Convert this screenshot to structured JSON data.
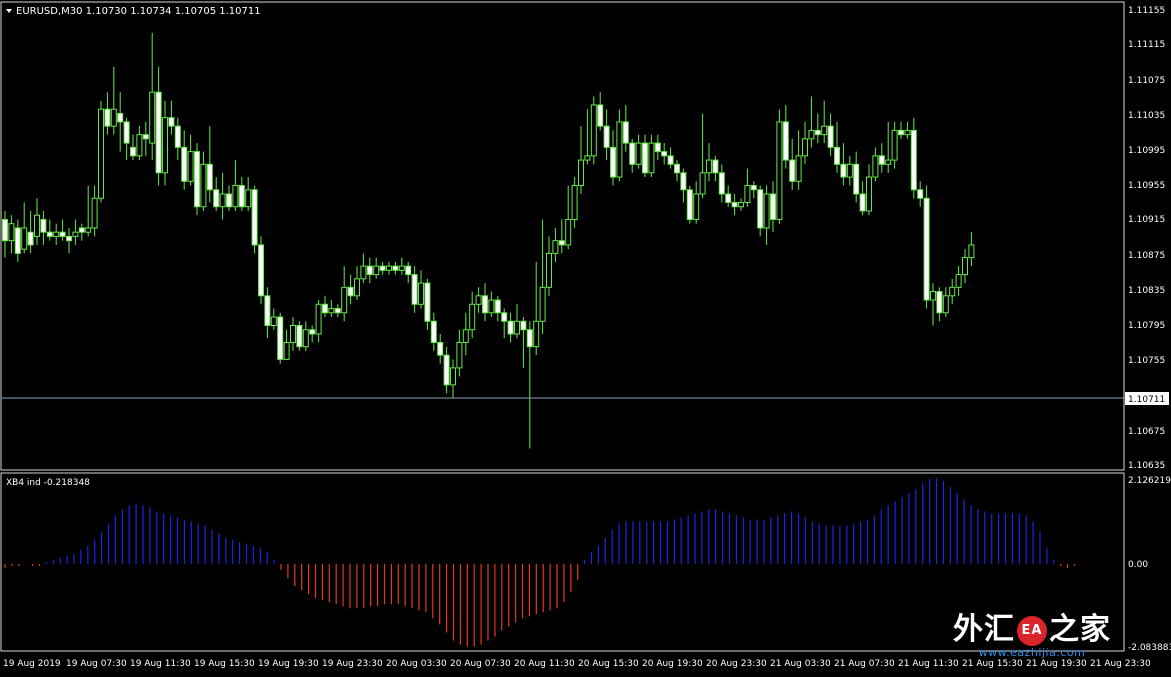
{
  "colors": {
    "background": "#000000",
    "frame": "#d9d9d9",
    "axis_text": "#ffffff",
    "candle": "#66e84a",
    "candle_bull_body": "#000000",
    "candle_bear_body": "#ffffff",
    "current_price_line": "#8aa2b5",
    "hist_positive": "#2222e6",
    "hist_negative": "#e23b1b"
  },
  "main_pane": {
    "symbol_menu_icon": "triangle-down-icon",
    "title": "EURUSD,M30  1.10730 1.10734 1.10705 1.10711",
    "price_labels": [
      "1.11155",
      "1.11115",
      "1.11075",
      "1.11035",
      "1.10995",
      "1.10955",
      "1.10915",
      "1.10875",
      "1.10835",
      "1.10795",
      "1.10755",
      "1.10675",
      "1.10635"
    ],
    "current_price": "1.10711"
  },
  "indicator_pane": {
    "title": "XB4 ind -0.218348",
    "labels": [
      "2.126219",
      "0.00",
      "-2.083883"
    ]
  },
  "time_axis": [
    "19 Aug 2019",
    "19 Aug 07:30",
    "19 Aug 11:30",
    "19 Aug 15:30",
    "19 Aug 19:30",
    "19 Aug 23:30",
    "20 Aug 03:30",
    "20 Aug 07:30",
    "20 Aug 11:30",
    "20 Aug 15:30",
    "20 Aug 19:30",
    "20 Aug 23:30",
    "21 Aug 03:30",
    "21 Aug 07:30",
    "21 Aug 11:30",
    "21 Aug 15:30",
    "21 Aug 19:30",
    "21 Aug 23:30"
  ],
  "watermark": {
    "text_left": "外汇",
    "badge": "EA",
    "text_right": "之家",
    "url": "www.eazhijia.com"
  },
  "chart_data": [
    {
      "type": "candlestick",
      "series": "EURUSD,M30",
      "ylim": [
        1.10627,
        1.11174
      ],
      "grid": false,
      "candles": [
        [
          1.1092,
          1.10895,
          1.10875,
          1.1093
        ],
        [
          1.10895,
          1.10915,
          1.1088,
          1.10925
        ],
        [
          1.1091,
          1.1088,
          1.1087,
          1.1092
        ],
        [
          1.10885,
          1.1091,
          1.1088,
          1.1094
        ],
        [
          1.10905,
          1.1089,
          1.1088,
          1.1093
        ],
        [
          1.109,
          1.10925,
          1.1089,
          1.10945
        ],
        [
          1.1092,
          1.10905,
          1.1089,
          1.1093
        ],
        [
          1.10905,
          1.109,
          1.10895,
          1.1092
        ],
        [
          1.109,
          1.10905,
          1.1089,
          1.10915
        ],
        [
          1.10905,
          1.109,
          1.10895,
          1.1092
        ],
        [
          1.109,
          1.10895,
          1.1088,
          1.1091
        ],
        [
          1.109,
          1.10905,
          1.1089,
          1.1092
        ],
        [
          1.1091,
          1.10905,
          1.10895,
          1.10915
        ],
        [
          1.10905,
          1.1091,
          1.109,
          1.1096
        ],
        [
          1.1091,
          1.10945,
          1.109,
          1.1096
        ],
        [
          1.10945,
          1.1105,
          1.1094,
          1.1106
        ],
        [
          1.1105,
          1.1103,
          1.1102,
          1.1107
        ],
        [
          1.1103,
          1.1105,
          1.1102,
          1.111
        ],
        [
          1.11045,
          1.11035,
          1.11,
          1.1107
        ],
        [
          1.11035,
          1.1101,
          1.1099,
          1.1104
        ],
        [
          1.11005,
          1.10995,
          1.1099,
          1.1102
        ],
        [
          1.10995,
          1.1102,
          1.1099,
          1.1103
        ],
        [
          1.1102,
          1.11015,
          1.10995,
          1.11035
        ],
        [
          1.1101,
          1.1107,
          1.1099,
          1.1114
        ],
        [
          1.1107,
          1.10975,
          1.1096,
          1.111
        ],
        [
          1.10975,
          1.1104,
          1.1096,
          1.1106
        ],
        [
          1.1104,
          1.1103,
          1.1102,
          1.1106
        ],
        [
          1.1103,
          1.11005,
          1.1099,
          1.1104
        ],
        [
          1.11005,
          1.10965,
          1.10955,
          1.11025
        ],
        [
          1.10965,
          1.11,
          1.1096,
          1.1102
        ],
        [
          1.11,
          1.10935,
          1.10925,
          1.1101
        ],
        [
          1.10935,
          1.10985,
          1.1093,
          1.11
        ],
        [
          1.10985,
          1.10955,
          1.1094,
          1.1103
        ],
        [
          1.10955,
          1.10935,
          1.1093,
          1.1097
        ],
        [
          1.10935,
          1.1095,
          1.1092,
          1.10975
        ],
        [
          1.1095,
          1.10935,
          1.1093,
          1.1096
        ],
        [
          1.10935,
          1.1096,
          1.1093,
          1.1099
        ],
        [
          1.1096,
          1.10935,
          1.1093,
          1.1097
        ],
        [
          1.10935,
          1.10955,
          1.1093,
          1.1097
        ],
        [
          1.10955,
          1.1089,
          1.1088,
          1.1096
        ],
        [
          1.1089,
          1.1083,
          1.1082,
          1.109
        ],
        [
          1.1083,
          1.10795,
          1.1078,
          1.1084
        ],
        [
          1.10795,
          1.10805,
          1.1079,
          1.10815
        ],
        [
          1.10805,
          1.10755,
          1.1075,
          1.1081
        ],
        [
          1.10755,
          1.10775,
          1.1076,
          1.1079
        ],
        [
          1.10775,
          1.10795,
          1.10765,
          1.10805
        ],
        [
          1.10795,
          1.1077,
          1.10765,
          1.108
        ],
        [
          1.1077,
          1.1079,
          1.10765,
          1.108
        ],
        [
          1.1079,
          1.10785,
          1.10775,
          1.10795
        ],
        [
          1.10785,
          1.1082,
          1.10775,
          1.10825
        ],
        [
          1.1082,
          1.1081,
          1.10805,
          1.1083
        ],
        [
          1.1081,
          1.10815,
          1.10805,
          1.10825
        ],
        [
          1.10815,
          1.1081,
          1.10805,
          1.1082
        ],
        [
          1.1081,
          1.1084,
          1.108,
          1.10865
        ],
        [
          1.1084,
          1.1083,
          1.1082,
          1.10855
        ],
        [
          1.1083,
          1.1085,
          1.10825,
          1.10865
        ],
        [
          1.1085,
          1.10865,
          1.10845,
          1.1088
        ],
        [
          1.10865,
          1.10855,
          1.10845,
          1.10875
        ],
        [
          1.10855,
          1.10865,
          1.1085,
          1.10875
        ],
        [
          1.10865,
          1.1086,
          1.10855,
          1.1087
        ],
        [
          1.1086,
          1.10865,
          1.10855,
          1.1087
        ],
        [
          1.10865,
          1.1086,
          1.10855,
          1.1087
        ],
        [
          1.1086,
          1.10865,
          1.10855,
          1.10875
        ],
        [
          1.10865,
          1.10855,
          1.10845,
          1.1087
        ],
        [
          1.10855,
          1.1082,
          1.1081,
          1.10865
        ],
        [
          1.1082,
          1.10845,
          1.10815,
          1.1086
        ],
        [
          1.10845,
          1.108,
          1.1079,
          1.1085
        ],
        [
          1.108,
          1.10775,
          1.10765,
          1.1081
        ],
        [
          1.10775,
          1.1076,
          1.1075,
          1.10785
        ],
        [
          1.1076,
          1.10725,
          1.10715,
          1.1077
        ],
        [
          1.10725,
          1.10745,
          1.1071,
          1.10755
        ],
        [
          1.10745,
          1.10775,
          1.10735,
          1.1079
        ],
        [
          1.10775,
          1.1079,
          1.1076,
          1.1081
        ],
        [
          1.1079,
          1.1082,
          1.1078,
          1.10835
        ],
        [
          1.1082,
          1.1083,
          1.1081,
          1.1084
        ],
        [
          1.1083,
          1.1081,
          1.108,
          1.10845
        ],
        [
          1.1081,
          1.10825,
          1.10805,
          1.10835
        ],
        [
          1.10825,
          1.1081,
          1.108,
          1.1083
        ],
        [
          1.1081,
          1.108,
          1.1078,
          1.10815
        ],
        [
          1.108,
          1.10785,
          1.10775,
          1.1081
        ],
        [
          1.10785,
          1.108,
          1.1078,
          1.1082
        ],
        [
          1.108,
          1.1079,
          1.10745,
          1.10805
        ],
        [
          1.1079,
          1.1077,
          1.1065,
          1.108
        ],
        [
          1.1077,
          1.108,
          1.1076,
          1.1087
        ],
        [
          1.108,
          1.1084,
          1.10785,
          1.1092
        ],
        [
          1.1084,
          1.1088,
          1.1083,
          1.109
        ],
        [
          1.1088,
          1.10895,
          1.1087,
          1.1091
        ],
        [
          1.10895,
          1.1089,
          1.1088,
          1.1092
        ],
        [
          1.1089,
          1.1092,
          1.10885,
          1.1096
        ],
        [
          1.1092,
          1.1096,
          1.1091,
          1.1097
        ],
        [
          1.1096,
          1.1099,
          1.1095,
          1.1103
        ],
        [
          1.1099,
          1.10995,
          1.10985,
          1.1105
        ],
        [
          1.10995,
          1.11055,
          1.10985,
          1.11065
        ],
        [
          1.11055,
          1.1103,
          1.11025,
          1.1107
        ],
        [
          1.1103,
          1.11005,
          1.1099,
          1.1105
        ],
        [
          1.11005,
          1.1097,
          1.1096,
          1.11025
        ],
        [
          1.1097,
          1.11035,
          1.10965,
          1.1105
        ],
        [
          1.11035,
          1.1101,
          1.11,
          1.11055
        ],
        [
          1.1101,
          1.10985,
          1.10975,
          1.11015
        ],
        [
          1.10985,
          1.1101,
          1.1098,
          1.1102
        ],
        [
          1.1101,
          1.10975,
          1.1097,
          1.1102
        ],
        [
          1.10975,
          1.1101,
          1.1097,
          1.1102
        ],
        [
          1.1101,
          1.11,
          1.1099,
          1.1102
        ],
        [
          1.11,
          1.10995,
          1.10985,
          1.1101
        ],
        [
          1.10995,
          1.10985,
          1.1098,
          1.11005
        ],
        [
          1.10985,
          1.10975,
          1.10965,
          1.1099
        ],
        [
          1.10975,
          1.10955,
          1.1094,
          1.1098
        ],
        [
          1.10955,
          1.1092,
          1.10915,
          1.1096
        ],
        [
          1.1092,
          1.1095,
          1.10915,
          1.10965
        ],
        [
          1.1095,
          1.10975,
          1.10945,
          1.11045
        ],
        [
          1.10975,
          1.1099,
          1.10965,
          1.1101
        ],
        [
          1.1099,
          1.10975,
          1.10965,
          1.10995
        ],
        [
          1.10975,
          1.1095,
          1.1094,
          1.10985
        ],
        [
          1.1095,
          1.1094,
          1.10935,
          1.1096
        ],
        [
          1.1094,
          1.10935,
          1.10925,
          1.1095
        ],
        [
          1.10935,
          1.1094,
          1.1093,
          1.10945
        ],
        [
          1.1094,
          1.1096,
          1.10935,
          1.1098
        ],
        [
          1.1096,
          1.10955,
          1.10945,
          1.10965
        ],
        [
          1.10955,
          1.1091,
          1.109,
          1.1096
        ],
        [
          1.1091,
          1.1095,
          1.1089,
          1.1096
        ],
        [
          1.1095,
          1.1092,
          1.10905,
          1.10965
        ],
        [
          1.1092,
          1.11035,
          1.10915,
          1.1105
        ],
        [
          1.11035,
          1.1099,
          1.1098,
          1.11055
        ],
        [
          1.1099,
          1.10965,
          1.10955,
          1.11015
        ],
        [
          1.10965,
          1.10995,
          1.10955,
          1.11025
        ],
        [
          1.10995,
          1.11015,
          1.10985,
          1.11035
        ],
        [
          1.11015,
          1.11025,
          1.11005,
          1.11065
        ],
        [
          1.11025,
          1.1102,
          1.1101,
          1.11045
        ],
        [
          1.1102,
          1.1103,
          1.1101,
          1.1106
        ],
        [
          1.1103,
          1.11005,
          1.10995,
          1.11045
        ],
        [
          1.11005,
          1.10985,
          1.10975,
          1.11035
        ],
        [
          1.10985,
          1.1097,
          1.1096,
          1.1101
        ],
        [
          1.1097,
          1.10985,
          1.1096,
          1.10995
        ],
        [
          1.10985,
          1.1095,
          1.1094,
          1.11
        ],
        [
          1.1095,
          1.1093,
          1.10925,
          1.10965
        ],
        [
          1.1093,
          1.1097,
          1.10925,
          1.10985
        ],
        [
          1.1097,
          1.10995,
          1.10965,
          1.11005
        ],
        [
          1.10995,
          1.10985,
          1.10975,
          1.1101
        ],
        [
          1.10985,
          1.1099,
          1.10975,
          1.11035
        ],
        [
          1.1099,
          1.11025,
          1.1098,
          1.11035
        ],
        [
          1.11025,
          1.1102,
          1.11015,
          1.11035
        ],
        [
          1.1102,
          1.11025,
          1.11015,
          1.11035
        ],
        [
          1.11025,
          1.10955,
          1.10945,
          1.1104
        ],
        [
          1.10955,
          1.10945,
          1.10935,
          1.10965
        ],
        [
          1.10945,
          1.10825,
          1.10815,
          1.1096
        ],
        [
          1.10825,
          1.10835,
          1.10795,
          1.10845
        ],
        [
          1.10835,
          1.1081,
          1.108,
          1.1084
        ],
        [
          1.1081,
          1.1083,
          1.10805,
          1.1084
        ],
        [
          1.1083,
          1.1084,
          1.1082,
          1.1085
        ],
        [
          1.1084,
          1.10855,
          1.1083,
          1.10865
        ],
        [
          1.10855,
          1.10875,
          1.10845,
          1.10885
        ],
        [
          1.10875,
          1.1089,
          1.10865,
          1.10905
        ]
      ]
    },
    {
      "type": "bar",
      "series": "XB4 ind",
      "ylim": [
        -2.083883,
        2.126219
      ],
      "values": [
        -0.1,
        -0.05,
        -0.05,
        0.0,
        -0.05,
        -0.05,
        0.05,
        0.1,
        0.15,
        0.2,
        0.25,
        0.35,
        0.45,
        0.6,
        0.8,
        1.0,
        1.2,
        1.35,
        1.45,
        1.5,
        1.45,
        1.4,
        1.3,
        1.25,
        1.2,
        1.15,
        1.1,
        1.05,
        1.0,
        0.95,
        0.85,
        0.75,
        0.65,
        0.6,
        0.55,
        0.5,
        0.45,
        0.4,
        0.3,
        0.1,
        -0.15,
        -0.35,
        -0.55,
        -0.65,
        -0.75,
        -0.85,
        -0.9,
        -0.95,
        -1.0,
        -1.05,
        -1.1,
        -1.1,
        -1.1,
        -1.05,
        -1.05,
        -1.0,
        -1.0,
        -1.0,
        -1.05,
        -1.1,
        -1.15,
        -1.2,
        -1.35,
        -1.5,
        -1.7,
        -1.9,
        -2.0,
        -2.05,
        -2.05,
        -2.0,
        -1.9,
        -1.8,
        -1.65,
        -1.55,
        -1.45,
        -1.35,
        -1.3,
        -1.25,
        -1.2,
        -1.15,
        -1.1,
        -0.95,
        -0.7,
        -0.4,
        0.1,
        0.3,
        0.45,
        0.65,
        0.85,
        1.0,
        1.05,
        1.05,
        1.05,
        1.05,
        1.05,
        1.05,
        1.05,
        1.1,
        1.15,
        1.2,
        1.25,
        1.3,
        1.35,
        1.35,
        1.3,
        1.25,
        1.2,
        1.15,
        1.1,
        1.1,
        1.1,
        1.15,
        1.2,
        1.25,
        1.3,
        1.25,
        1.15,
        1.05,
        1.0,
        0.95,
        0.95,
        0.95,
        0.95,
        1.0,
        1.05,
        1.1,
        1.2,
        1.35,
        1.45,
        1.55,
        1.65,
        1.75,
        1.85,
        2.0,
        2.1,
        2.12,
        2.05,
        1.9,
        1.75,
        1.6,
        1.45,
        1.35,
        1.3,
        1.25,
        1.25,
        1.25,
        1.25,
        1.25,
        1.2,
        1.05,
        0.8,
        0.4,
        0.1,
        -0.05,
        -0.1,
        -0.05,
        0.0,
        0.0,
        0.0,
        0.0
      ]
    }
  ]
}
